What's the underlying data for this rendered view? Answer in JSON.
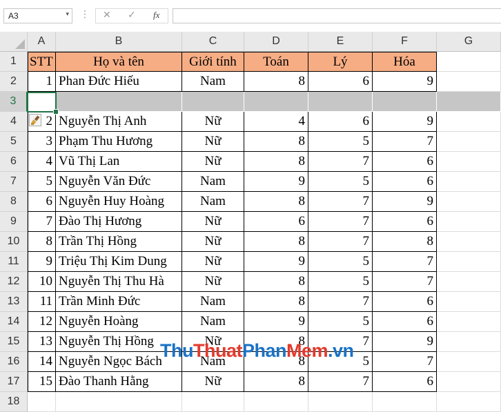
{
  "name_box": {
    "value": "A3",
    "arrow": "▾"
  },
  "formula_bar": {
    "dots": "⋮",
    "cancel": "✕",
    "enter": "✓",
    "fx": "fx",
    "value": ""
  },
  "columns": [
    "A",
    "B",
    "C",
    "D",
    "E",
    "F",
    "G"
  ],
  "row_numbers": [
    "1",
    "2",
    "3",
    "4",
    "5",
    "6",
    "7",
    "8",
    "9",
    "10",
    "11",
    "12",
    "13",
    "14",
    "15",
    "16",
    "17",
    "18"
  ],
  "table": {
    "headers": [
      "STT",
      "Họ và tên",
      "Giới tính",
      "Toán",
      "Lý",
      "Hóa"
    ],
    "rows": [
      [
        "1",
        "Phan Đức Hiếu",
        "Nam",
        "8",
        "6",
        "9"
      ],
      [
        "",
        "",
        "",
        "",
        "",
        ""
      ],
      [
        "2",
        "Nguyễn Thị Anh",
        "Nữ",
        "4",
        "6",
        "9"
      ],
      [
        "3",
        "Phạm Thu Hương",
        "Nữ",
        "8",
        "5",
        "7"
      ],
      [
        "4",
        "Vũ Thị Lan",
        "Nữ",
        "8",
        "7",
        "6"
      ],
      [
        "5",
        "Nguyễn Văn Đức",
        "Nam",
        "9",
        "5",
        "6"
      ],
      [
        "6",
        "Nguyễn Huy Hoàng",
        "Nam",
        "8",
        "7",
        "9"
      ],
      [
        "7",
        "Đào Thị Hương",
        "Nữ",
        "6",
        "7",
        "6"
      ],
      [
        "8",
        "Trần Thị Hồng",
        "Nữ",
        "8",
        "7",
        "8"
      ],
      [
        "9",
        "Triệu Thị Kim Dung",
        "Nữ",
        "9",
        "5",
        "7"
      ],
      [
        "10",
        "Nguyễn Thị Thu Hà",
        "Nữ",
        "8",
        "5",
        "7"
      ],
      [
        "11",
        "Trần Minh Đức",
        "Nam",
        "8",
        "7",
        "6"
      ],
      [
        "12",
        "Nguyễn Hoàng",
        "Nam",
        "9",
        "5",
        "6"
      ],
      [
        "13",
        "Nguyễn Thị Hồng",
        "Nữ",
        "8",
        "7",
        "9"
      ],
      [
        "14",
        "Nguyễn Ngọc Bách",
        "Nam",
        "8",
        "5",
        "7"
      ],
      [
        "15",
        "Đào Thanh Hằng",
        "Nữ",
        "8",
        "7",
        "6"
      ]
    ]
  },
  "watermark": {
    "part1": "Thu",
    "part2": "Thuat",
    "part3": "Phan",
    "part4": "Mem",
    "part5": ".vn"
  },
  "colors": {
    "header_fill": "#f7ad84",
    "inserted_row_fill": "#c6c6c6",
    "selection": "#217346"
  },
  "icons": {
    "insert_options": "paintbrush-icon",
    "corner": "select-all-triangle-icon"
  }
}
